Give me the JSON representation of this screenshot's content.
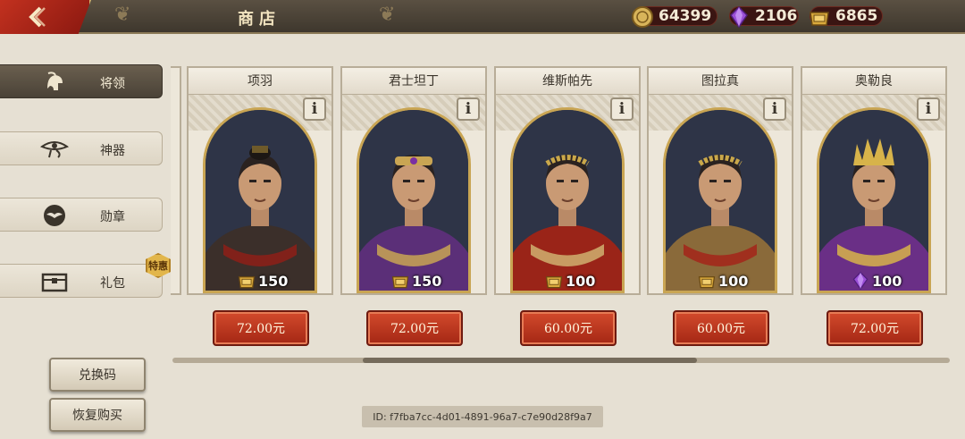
{
  "header": {
    "title": "商店",
    "back_icon": "back-arrow-icon",
    "colors": {
      "bar": "#4a4237",
      "back": "#b32a19",
      "accent": "#d7b56d"
    }
  },
  "currencies": [
    {
      "icon": "gold-coin-icon",
      "value": "64399"
    },
    {
      "icon": "purple-gem-icon",
      "value": "2106"
    },
    {
      "icon": "gold-ingot-icon",
      "value": "6865"
    }
  ],
  "sidebar": {
    "items": [
      {
        "label": "将领",
        "icon": "helmet-icon",
        "active": true
      },
      {
        "label": "神器",
        "icon": "eye-of-horus-icon",
        "active": false
      },
      {
        "label": "勋章",
        "icon": "eagle-medal-icon",
        "active": false
      },
      {
        "label": "礼包",
        "icon": "chest-icon",
        "active": false
      }
    ],
    "badge": "特惠",
    "redeem_label": "兑换码",
    "restore_label": "恢复购买"
  },
  "cards": [
    {
      "name": "项羽",
      "reward": "150",
      "reward_icon": "gold-ingot-icon",
      "price": "72.00元"
    },
    {
      "name": "君士坦丁",
      "reward": "150",
      "reward_icon": "gold-ingot-icon",
      "price": "72.00元"
    },
    {
      "name": "维斯帕先",
      "reward": "100",
      "reward_icon": "gold-ingot-icon",
      "price": "60.00元"
    },
    {
      "name": "图拉真",
      "reward": "100",
      "reward_icon": "gold-ingot-icon",
      "price": "60.00元"
    },
    {
      "name": "奥勒良",
      "reward": "100",
      "reward_icon": "purple-gem-icon",
      "price": "72.00元"
    }
  ],
  "info_label": "i",
  "scroll": {
    "position": 0.43
  },
  "footer": {
    "id_text": "ID: f7fba7cc-4d01-4891-96a7-c7e90d28f9a7"
  }
}
